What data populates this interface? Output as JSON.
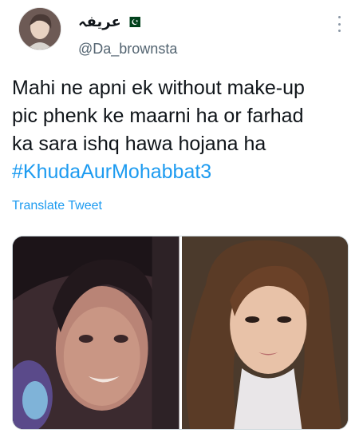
{
  "tweet": {
    "display_name": "عریفہ",
    "flag_icon": "pakistan-flag-icon",
    "handle": "@Da_brownsta",
    "more_icon": "more-vertical-icon",
    "text_lines": [
      "Mahi ne apni ek without make-up",
      "pic phenk ke maarni ha or farhad",
      "ka sara ishq hawa hojana ha"
    ],
    "hashtag": "#KhudaAurMohabbat3",
    "translate_label": "Translate Tweet",
    "colors": {
      "link": "#1d9bf0",
      "text": "#0f1419",
      "muted": "#536471"
    }
  },
  "media": {
    "images": [
      {
        "name": "photo-without-makeup"
      },
      {
        "name": "photo-with-makeup"
      }
    ]
  }
}
